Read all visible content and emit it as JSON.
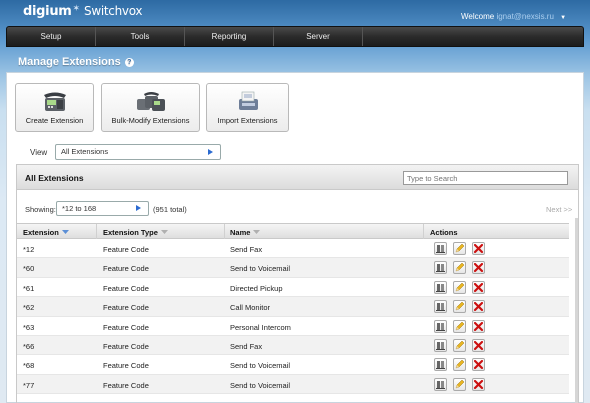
{
  "header": {
    "brand": "digium",
    "product": "Switchvox",
    "welcome_prefix": "Welcome",
    "user": "ignat@nexsis.ru"
  },
  "nav": [
    {
      "label": "Setup"
    },
    {
      "label": "Tools"
    },
    {
      "label": "Reporting"
    },
    {
      "label": "Server"
    }
  ],
  "page": {
    "title": "Manage Extensions"
  },
  "actions": {
    "create": "Create Extension",
    "bulk": "Bulk-Modify Extensions",
    "import": "Import Extensions"
  },
  "view": {
    "label": "View",
    "selected": "All Extensions"
  },
  "extensions_panel": {
    "title": "All Extensions",
    "search_placeholder": "Type to Search",
    "showing_label": "Showing:",
    "showing_selected": "*12 to 168",
    "total": "(951 total)",
    "next": "Next >>"
  },
  "table": {
    "columns": [
      "Extension",
      "Extension Type",
      "Name",
      "Actions"
    ],
    "rows": [
      {
        "extension": "*12",
        "type": "Feature Code",
        "name": "Send Fax"
      },
      {
        "extension": "*60",
        "type": "Feature Code",
        "name": "Send to Voicemail"
      },
      {
        "extension": "*61",
        "type": "Feature Code",
        "name": "Directed Pickup"
      },
      {
        "extension": "*62",
        "type": "Feature Code",
        "name": "Call Monitor"
      },
      {
        "extension": "*63",
        "type": "Feature Code",
        "name": "Personal Intercom"
      },
      {
        "extension": "*66",
        "type": "Feature Code",
        "name": "Send Fax"
      },
      {
        "extension": "*68",
        "type": "Feature Code",
        "name": "Send to Voicemail"
      },
      {
        "extension": "*77",
        "type": "Feature Code",
        "name": "Send to Voicemail"
      }
    ]
  },
  "icons": {
    "phone": "phone-icon",
    "phones": "multi-phone-icon",
    "import": "import-icon",
    "view_arrow": "arrow-right-icon",
    "sort": "sort-icon",
    "details": "details-icon",
    "edit": "edit-pencil-icon",
    "delete": "delete-x-icon"
  },
  "colors": {
    "accent_blue": "#2c6bd1",
    "delete_red": "#cc1111",
    "nav_dark": "#2b2b2b"
  }
}
